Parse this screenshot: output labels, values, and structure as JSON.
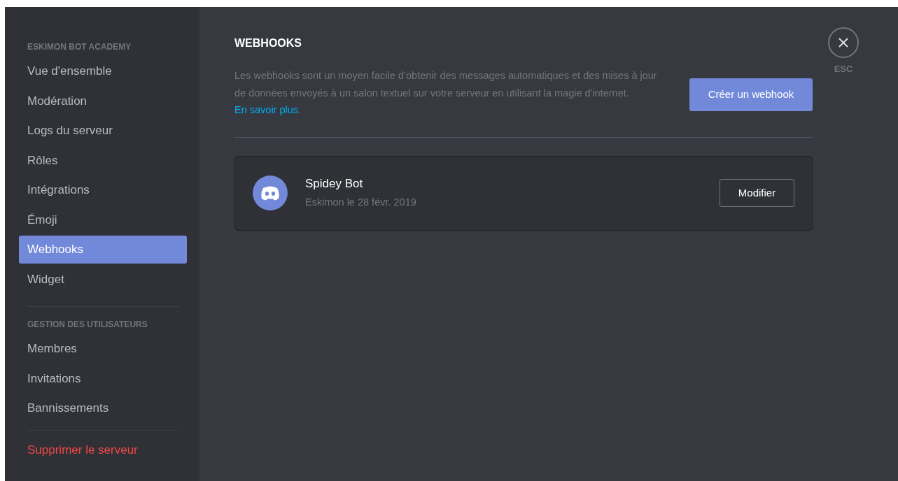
{
  "sidebar": {
    "sections": [
      {
        "header": "ESKIMON BOT ACADEMY",
        "items": [
          {
            "label": "Vue d'ensemble",
            "selected": false
          },
          {
            "label": "Modération",
            "selected": false
          },
          {
            "label": "Logs du serveur",
            "selected": false
          },
          {
            "label": "Rôles",
            "selected": false
          },
          {
            "label": "Intégrations",
            "selected": false
          },
          {
            "label": "Émoji",
            "selected": false
          },
          {
            "label": "Webhooks",
            "selected": true
          },
          {
            "label": "Widget",
            "selected": false
          }
        ]
      },
      {
        "header": "GESTION DES UTILISATEURS",
        "items": [
          {
            "label": "Membres",
            "selected": false
          },
          {
            "label": "Invitations",
            "selected": false
          },
          {
            "label": "Bannissements",
            "selected": false
          }
        ]
      }
    ],
    "delete_action": "Supprimer le serveur"
  },
  "page": {
    "title": "WEBHOOKS",
    "description": "Les webhooks sont un moyen facile d’obtenir des messages automatiques et des mises à jour de données envoyés à un salon textuel sur votre serveur en utilisant la magie d'internet.",
    "link": "En savoir plus",
    "link_suffix": ".",
    "create_button": "Créer un webhook",
    "webhooks": [
      {
        "name": "Spidey Bot",
        "subtitle": "Eskimon le 28 févr. 2019",
        "edit_button": "Modifier"
      }
    ]
  },
  "close": {
    "label": "ESC"
  }
}
